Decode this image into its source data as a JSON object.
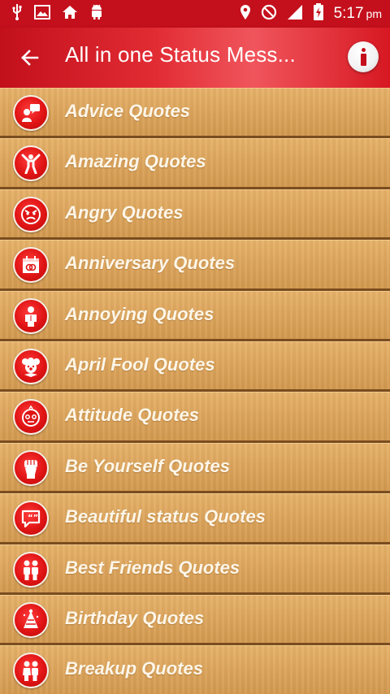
{
  "status_bar": {
    "time": "5:17",
    "ampm": "pm",
    "icons": [
      "usb-icon",
      "image-icon",
      "home-icon",
      "android-icon",
      "location-icon",
      "do-not-disturb-icon",
      "signal-icon",
      "battery-charging-icon"
    ]
  },
  "app_bar": {
    "title": "All in one Status Mess...",
    "back_icon": "arrow-back-icon",
    "info_icon": "info-icon"
  },
  "list": {
    "items": [
      {
        "label": "Advice Quotes",
        "icon": "advice-icon"
      },
      {
        "label": "Amazing Quotes",
        "icon": "amazing-icon"
      },
      {
        "label": "Angry Quotes",
        "icon": "angry-face-icon"
      },
      {
        "label": "Anniversary Quotes",
        "icon": "anniversary-calendar-icon"
      },
      {
        "label": "Annoying Quotes",
        "icon": "annoying-person-icon"
      },
      {
        "label": "April Fool Quotes",
        "icon": "clown-icon"
      },
      {
        "label": "Attitude Quotes",
        "icon": "attitude-face-icon"
      },
      {
        "label": "Be Yourself Quotes",
        "icon": "raised-fist-icon"
      },
      {
        "label": "Beautiful status Quotes",
        "icon": "quote-bubble-icon"
      },
      {
        "label": "Best Friends Quotes",
        "icon": "friends-icon"
      },
      {
        "label": "Birthday Quotes",
        "icon": "party-hat-icon"
      },
      {
        "label": "Breakup Quotes",
        "icon": "couple-icon"
      }
    ]
  },
  "colors": {
    "status_bar": "#c4101c",
    "app_bar": "#e22c34",
    "row_wood": "#dca45c",
    "row_separator": "#7a4d1f",
    "icon_red": "#e01414"
  }
}
